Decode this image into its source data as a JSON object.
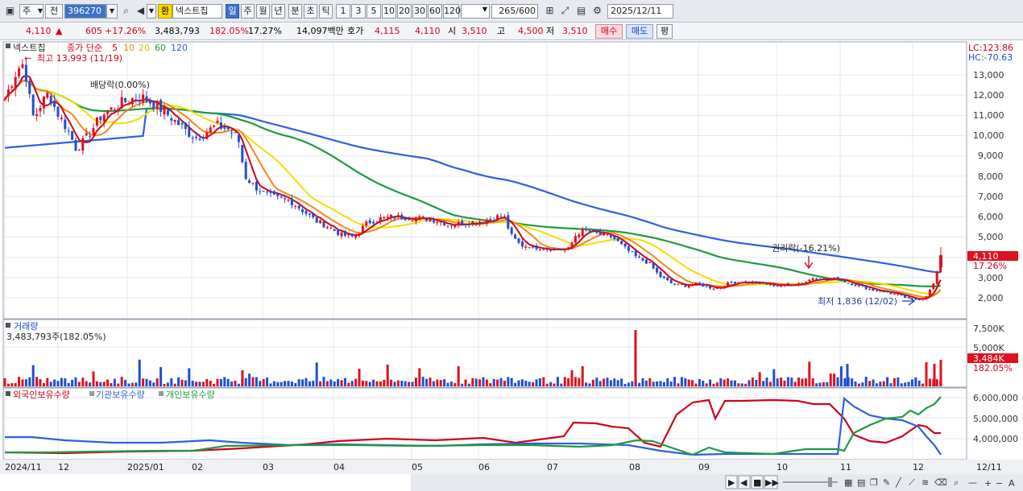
{
  "toolbar": {
    "period_jsu": "주",
    "period_jeon": "전",
    "stock_code": "396270",
    "hwan": "환",
    "stock_name": "넥스트칩",
    "periods": [
      "일",
      "주",
      "월",
      "년",
      "분",
      "초",
      "틱"
    ],
    "intervals": [
      "1",
      "3",
      "5",
      "10",
      "20",
      "30",
      "60",
      "120"
    ],
    "count": "265",
    "count_total": "/600",
    "date": "2025/12/11"
  },
  "quote": {
    "price": "4,110",
    "change_arrow": "▲",
    "change": "605",
    "change_pct": "+17.26%",
    "volume": "3,483,793",
    "volume_ratio": "182.05%",
    "turnover_rate": "17.27%",
    "amount": "14,097백만",
    "bid_label": "호가",
    "ask_price": "4,115",
    "bid_price": "4,110",
    "open_label": "시",
    "open": "3,510",
    "high_label": "고",
    "high": "4,500",
    "low_label": "저",
    "low": "3,510",
    "buy_button": "매수",
    "sell_button": "매도",
    "eval_button": "평"
  },
  "price_panel": {
    "name": "넥스트칩",
    "ma_label": "종가 단순",
    "ma_periods": [
      "5",
      "10",
      "20",
      "60",
      "120"
    ],
    "ma_colors": [
      "#d0021b",
      "#f08a14",
      "#f2df00",
      "#1e9a3f",
      "#2f5fe0"
    ],
    "lc": "LC:123.86",
    "hc": "HC:-70.63",
    "high_note": "최고 13,993 (11/19)",
    "dividend_note": "배당락(0.00%)",
    "rights_note": "권리락(-16.21%)",
    "low_note": "최저 1,836 (12/02)",
    "current_price_tag": "4,110",
    "current_change_tag": "17.26%",
    "y_ticks": [
      "13,000",
      "12,000",
      "11,000",
      "10,000",
      "9,000",
      "8,000",
      "7,000",
      "6,000",
      "5,000",
      "4,000",
      "3,000",
      "2,000"
    ]
  },
  "volume_panel": {
    "title": "거래량",
    "value": "3,483,793주(182.05%)",
    "y_ticks": [
      "7,500K",
      "5,000K"
    ],
    "current_tag": "3,484K",
    "current_pct": "182.05%"
  },
  "holding_panel": {
    "legend": [
      "외국인보유수량",
      "기관보유수량",
      "개인보유수량"
    ],
    "colors": [
      "#d0021b",
      "#2f5fe0",
      "#1e9a3f"
    ],
    "y_ticks": [
      "6,000,000",
      "5,000,000",
      "4,000,000"
    ]
  },
  "x_axis": {
    "labels": [
      "2024/11",
      "12",
      "2025/01",
      "02",
      "03",
      "04",
      "05",
      "06",
      "07",
      "08",
      "09",
      "10",
      "11",
      "12"
    ],
    "right_label": "12/11"
  },
  "bottom_controls": {
    "buttons": [
      "▶",
      "◀",
      "■",
      "▶▶"
    ],
    "tools": [
      "+",
      "−",
      "A"
    ]
  },
  "chart_data": {
    "type": "candlestick",
    "title": "넥스트칩",
    "period_start": "2024/11",
    "period_end": "2025/12/11",
    "price_ylim": [
      1500,
      14000
    ],
    "close_approx": [
      {
        "x": "2024/11",
        "y": 11800
      },
      {
        "x": "2024/11",
        "y": 13400
      },
      {
        "x": "12",
        "y": 10900
      },
      {
        "x": "12",
        "y": 9700
      },
      {
        "x": "2025/01",
        "y": 11600
      },
      {
        "x": "2025/01",
        "y": 11900
      },
      {
        "x": "02",
        "y": 10400
      },
      {
        "x": "02",
        "y": 10100
      },
      {
        "x": "03",
        "y": 7700
      },
      {
        "x": "03",
        "y": 6900
      },
      {
        "x": "04",
        "y": 5100
      },
      {
        "x": "04",
        "y": 5900
      },
      {
        "x": "05",
        "y": 5900
      },
      {
        "x": "05",
        "y": 5800
      },
      {
        "x": "06",
        "y": 6000
      },
      {
        "x": "06",
        "y": 4600
      },
      {
        "x": "07",
        "y": 4400
      },
      {
        "x": "07",
        "y": 5100
      },
      {
        "x": "08",
        "y": 3900
      },
      {
        "x": "08",
        "y": 2700
      },
      {
        "x": "09",
        "y": 2600
      },
      {
        "x": "09",
        "y": 2750
      },
      {
        "x": "10",
        "y": 2600
      },
      {
        "x": "10",
        "y": 2900
      },
      {
        "x": "11",
        "y": 2600
      },
      {
        "x": "11",
        "y": 2300
      },
      {
        "x": "12",
        "y": 1900
      },
      {
        "x": "12/11",
        "y": 4110
      }
    ],
    "volume_ylim": [
      0,
      8000000
    ]
  }
}
